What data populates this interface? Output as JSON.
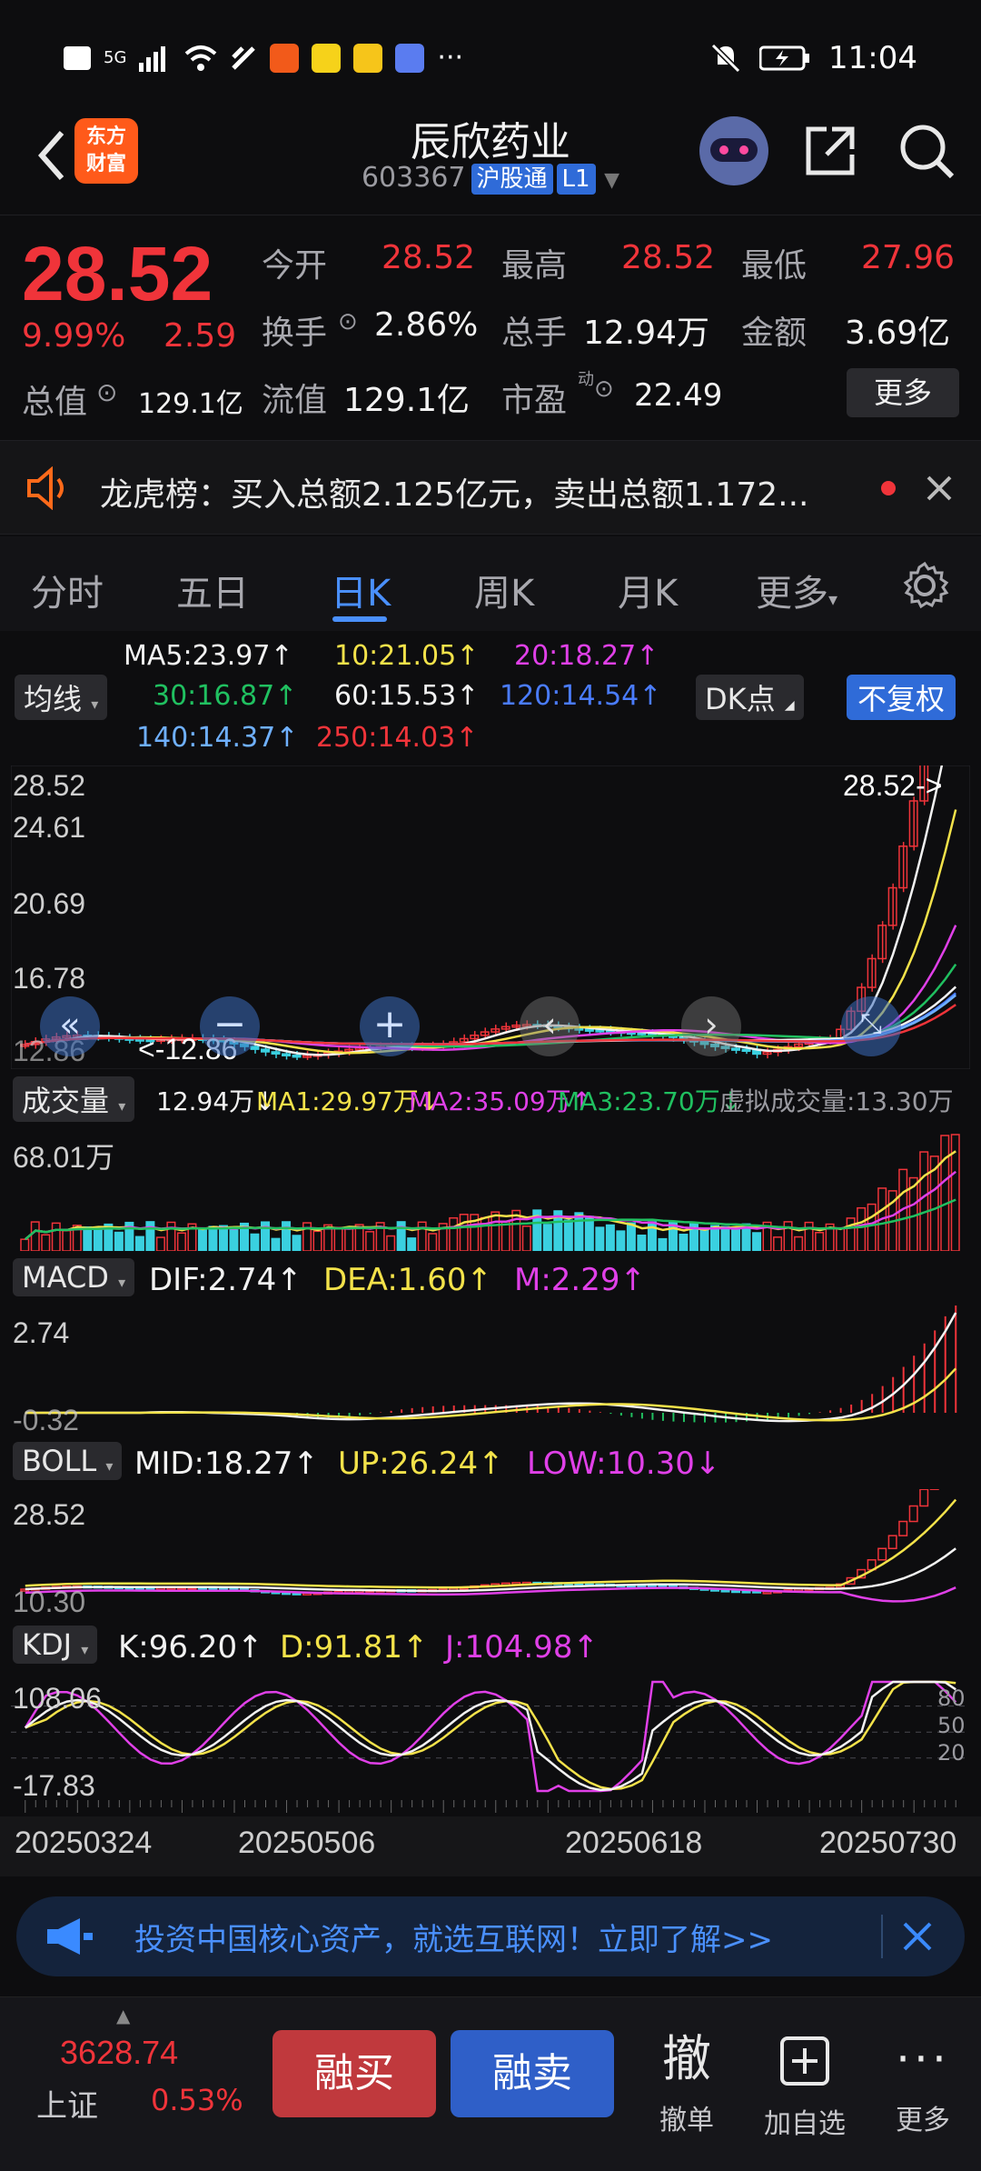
{
  "status_bar": {
    "time": "11:04",
    "network": "5G"
  },
  "header": {
    "brand": "东方财富",
    "stock_name": "辰欣药业",
    "stock_code": "603367",
    "connect_tag": "沪股通",
    "level_tag": "L1"
  },
  "quote": {
    "price": "28.52",
    "change_pct": "9.99%",
    "change_amt": "2.59",
    "open_label": "今开",
    "open": "28.52",
    "high_label": "最高",
    "high": "28.52",
    "low_label": "最低",
    "low": "27.96",
    "turnover_label": "换手",
    "turnover": "2.86%",
    "volume_label": "总手",
    "volume": "12.94万",
    "amount_label": "金额",
    "amount": "3.69亿",
    "mktcap_label": "总值",
    "mktcap": "129.1亿",
    "float_label": "流值",
    "float_cap": "129.1亿",
    "pe_label": "市盈",
    "pe_sup": "动",
    "pe": "22.49",
    "more_label": "更多"
  },
  "notice": {
    "text": "龙虎榜：买入总额2.125亿元，卖出总额1.172..."
  },
  "tabs": [
    {
      "label": "分时"
    },
    {
      "label": "五日"
    },
    {
      "label": "日K"
    },
    {
      "label": "周K"
    },
    {
      "label": "月K"
    },
    {
      "label": "更多"
    }
  ],
  "ma_legend": {
    "selector": "均线",
    "ma5": "MA5:23.97",
    "ma10": "10:21.05",
    "ma20": "20:18.27",
    "ma30": "30:16.87",
    "ma60": "60:15.53",
    "ma120": "120:14.54",
    "ma140": "140:14.37",
    "ma250": "250:14.03",
    "dk": "DK点",
    "adjust": "不复权",
    "colors": {
      "ma5": "#f2f2f2",
      "ma10": "#f3e24a",
      "ma20": "#e040e8",
      "ma30": "#20c060",
      "ma60": "#f2f2f2",
      "ma120": "#4a7cff",
      "ma140": "#6fb0ff",
      "ma250": "#f0343a"
    }
  },
  "kline": {
    "y_labels": [
      "28.52",
      "24.61",
      "20.69",
      "16.78",
      "12.86"
    ],
    "last_price_marker": "28.52->",
    "low_marker": "<-12.86"
  },
  "volume_panel": {
    "selector": "成交量",
    "vol": "12.94万",
    "ma1": "MA1:29.97万",
    "ma2": "MA2:35.09万",
    "ma3": "MA3:23.70万",
    "virtual": "虚拟成交量:13.30万",
    "y_label": "68.01万"
  },
  "macd_panel": {
    "selector": "MACD",
    "dif": "DIF:2.74",
    "dea": "DEA:1.60",
    "m": "M:2.29",
    "y_top": "2.74",
    "y_bottom": "-0.32"
  },
  "boll_panel": {
    "selector": "BOLL",
    "mid": "MID:18.27",
    "up": "UP:26.24",
    "low": "LOW:10.30",
    "y_top": "28.52",
    "y_bottom": "10.30"
  },
  "kdj_panel": {
    "selector": "KDJ",
    "k": "K:96.20",
    "d": "D:91.81",
    "j": "J:104.98",
    "y_top": "108.06",
    "y_bottom": "-17.83",
    "levels": [
      "80",
      "50",
      "20"
    ]
  },
  "x_axis": {
    "dates": [
      "20250324",
      "20250506",
      "20250618",
      "20250730"
    ]
  },
  "banner": {
    "text": "投资中国核心资产，就选互联网！立即了解>>"
  },
  "bottom_nav": {
    "index_value": "3628.74",
    "index_name": "上证",
    "index_pct": "0.53%",
    "buy_label": "融买",
    "sell_label": "融卖",
    "cancel_icon_text": "撤",
    "cancel_label": "撤单",
    "add_label": "加自选",
    "more_label": "更多"
  }
}
